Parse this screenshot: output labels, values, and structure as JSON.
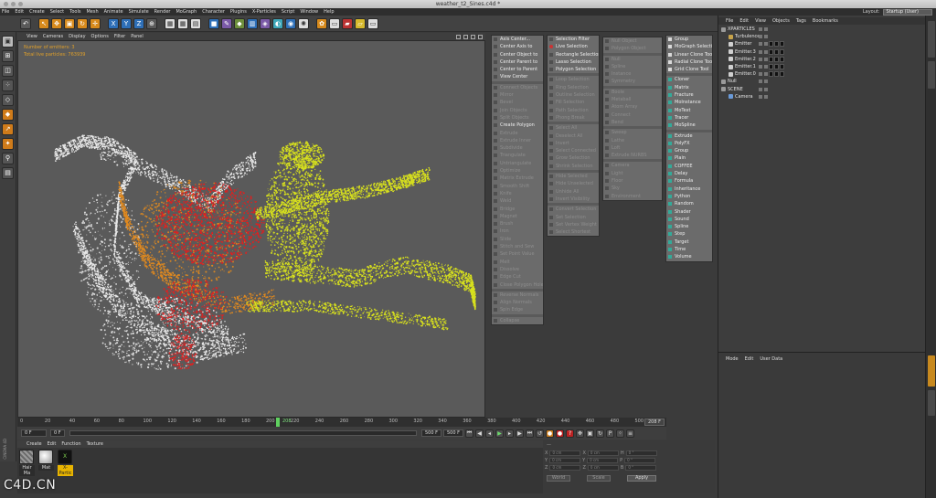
{
  "window": {
    "title": "weather_t2_Sines.c4d *"
  },
  "menubar": [
    "File",
    "Edit",
    "Create",
    "Select",
    "Tools",
    "Mesh",
    "Animate",
    "Simulate",
    "Render",
    "MoGraph",
    "Character",
    "Plugins",
    "X-Particles",
    "Script",
    "Window",
    "Help"
  ],
  "layout": {
    "label": "Layout:",
    "value": "Startup (User)"
  },
  "viewport": {
    "menu": [
      "View",
      "Cameras",
      "Display",
      "Options",
      "Filter",
      "Panel"
    ],
    "hud": [
      "Number of emitters: 3",
      "Total live particles: 763939"
    ],
    "colors": {
      "white": "#e8e8e8",
      "orange": "#e0891f",
      "red": "#e02020",
      "yellow": "#d7e01e",
      "bg": "#5a5a5a"
    }
  },
  "timeline": {
    "ticks": [
      "0",
      "20",
      "40",
      "60",
      "80",
      "100",
      "120",
      "140",
      "160",
      "180",
      "200",
      "220",
      "240",
      "260",
      "280",
      "300",
      "320",
      "340",
      "360",
      "380",
      "400",
      "420",
      "440",
      "460",
      "480",
      "500"
    ],
    "current": "208",
    "end": "208 F"
  },
  "transport": {
    "start": "0 F",
    "start2": "0 F",
    "end": "500 F",
    "end2": "500 F"
  },
  "materials": {
    "menu": [
      "Create",
      "Edit",
      "Function",
      "Texture"
    ],
    "items": [
      {
        "name": "Hair Ma",
        "color": "#8a8a8a"
      },
      {
        "name": "Mat",
        "color": "#e6e6e6"
      },
      {
        "name": "X-Partic",
        "color": "#1c1c1c"
      }
    ]
  },
  "coords": {
    "rows": [
      {
        "a": "X",
        "av": "0 cm",
        "b": "X",
        "bv": "0 cm",
        "c": "H",
        "cv": "0 °"
      },
      {
        "a": "Y",
        "av": "0 cm",
        "b": "Y",
        "bv": "0 cm",
        "c": "P",
        "cv": "0 °"
      },
      {
        "a": "Z",
        "av": "0 cm",
        "b": "Z",
        "bv": "0 cm",
        "c": "B",
        "cv": "0 °"
      }
    ],
    "mode1": "World",
    "mode2": "Scale",
    "apply": "Apply"
  },
  "menus": {
    "col1": [
      {
        "label": "Axis Center...",
        "dim": false
      },
      {
        "label": "Center Axis to",
        "dim": false
      },
      {
        "label": "Center Object to",
        "dim": false
      },
      {
        "label": "Center Parent to",
        "dim": false
      },
      {
        "label": "Center to Parent",
        "dim": false
      },
      {
        "label": "View Center",
        "dim": false
      },
      {
        "label": "---"
      },
      {
        "label": "Connect Objects",
        "dim": true
      },
      {
        "label": "Mirror",
        "dim": true
      },
      {
        "label": "Bevel",
        "dim": true
      },
      {
        "label": "Join Objects",
        "dim": true
      },
      {
        "label": "Split Objects",
        "dim": true
      },
      {
        "label": "Create Polygon",
        "dim": false
      },
      {
        "label": "Extrude",
        "dim": true
      },
      {
        "label": "Extrude Inner",
        "dim": true
      },
      {
        "label": "Subdivide",
        "dim": true
      },
      {
        "label": "Triangulate",
        "dim": true
      },
      {
        "label": "Untriangulate",
        "dim": true
      },
      {
        "label": "Optimize",
        "dim": true
      },
      {
        "label": "Matrix Extrude",
        "dim": true
      },
      {
        "label": "Smooth Shift",
        "dim": true
      },
      {
        "label": "Knife",
        "dim": true
      },
      {
        "label": "Weld",
        "dim": true
      },
      {
        "label": "Bridge",
        "dim": true
      },
      {
        "label": "Magnet",
        "dim": true
      },
      {
        "label": "Brush",
        "dim": true
      },
      {
        "label": "Iron",
        "dim": true
      },
      {
        "label": "Slide",
        "dim": true
      },
      {
        "label": "Stitch and Sew",
        "dim": true
      },
      {
        "label": "Set Point Value",
        "dim": true
      },
      {
        "label": "Melt",
        "dim": true
      },
      {
        "label": "Dissolve",
        "dim": true
      },
      {
        "label": "Edge Cut",
        "dim": true
      },
      {
        "label": "Close Polygon Hole",
        "dim": true
      },
      {
        "label": "---"
      },
      {
        "label": "Reverse Normals",
        "dim": true
      },
      {
        "label": "Align Normals",
        "dim": true
      },
      {
        "label": "Spin Edge",
        "dim": true
      },
      {
        "label": "---"
      },
      {
        "label": "Collapse",
        "dim": true
      }
    ],
    "col2": [
      {
        "label": "Selection Filter",
        "dim": false
      },
      {
        "label": "Live Selection",
        "dim": false,
        "dot": true
      },
      {
        "label": "Rectangle Selection",
        "dim": false
      },
      {
        "label": "Lasso Selection",
        "dim": false
      },
      {
        "label": "Polygon Selection",
        "dim": false
      },
      {
        "label": "---"
      },
      {
        "label": "Loop Selection",
        "dim": true
      },
      {
        "label": "Ring Selection",
        "dim": true
      },
      {
        "label": "Outline Selection",
        "dim": true
      },
      {
        "label": "Fill Selection",
        "dim": true
      },
      {
        "label": "Path Selection",
        "dim": true
      },
      {
        "label": "Phong Break",
        "dim": true
      },
      {
        "label": "---"
      },
      {
        "label": "Select All",
        "dim": true
      },
      {
        "label": "Deselect All",
        "dim": true
      },
      {
        "label": "Invert",
        "dim": true
      },
      {
        "label": "Select Connected",
        "dim": true
      },
      {
        "label": "Grow Selection",
        "dim": true
      },
      {
        "label": "Shrink Selection",
        "dim": true
      },
      {
        "label": "---"
      },
      {
        "label": "Hide Selected",
        "dim": true
      },
      {
        "label": "Hide Unselected",
        "dim": true
      },
      {
        "label": "Unhide All",
        "dim": true
      },
      {
        "label": "Invert Visibility",
        "dim": true
      },
      {
        "label": "---"
      },
      {
        "label": "Convert Selection",
        "dim": true
      },
      {
        "label": "Set Selection",
        "dim": true
      },
      {
        "label": "Set Vertex Weight",
        "dim": true
      },
      {
        "label": "Select Shortest",
        "dim": true
      }
    ],
    "col3": [
      {
        "label": "Null Object",
        "dim": true
      },
      {
        "label": "Polygon Object",
        "dim": true
      },
      {
        "label": "---"
      },
      {
        "label": "Null",
        "dim": true
      },
      {
        "label": "Spline",
        "dim": true
      },
      {
        "label": "Instance",
        "dim": true
      },
      {
        "label": "Symmetry",
        "dim": true
      },
      {
        "label": "---"
      },
      {
        "label": "Boole",
        "dim": true
      },
      {
        "label": "Metaball",
        "dim": true
      },
      {
        "label": "Atom Array",
        "dim": true
      },
      {
        "label": "Connect",
        "dim": true
      },
      {
        "label": "Bend",
        "dim": true
      },
      {
        "label": "---"
      },
      {
        "label": "Sweep",
        "dim": true
      },
      {
        "label": "Lathe",
        "dim": true
      },
      {
        "label": "Loft",
        "dim": true
      },
      {
        "label": "Extrude NURBS",
        "dim": true
      },
      {
        "label": "---"
      },
      {
        "label": "Camera",
        "dim": true
      },
      {
        "label": "Light",
        "dim": true
      },
      {
        "label": "Floor",
        "dim": true
      },
      {
        "label": "Sky",
        "dim": true
      },
      {
        "label": "Environment",
        "dim": true
      }
    ],
    "col4": [
      {
        "label": "Group",
        "dim": false,
        "cls": "ic2"
      },
      {
        "label": "MoGraph Selection",
        "dim": false,
        "cls": "ic2"
      },
      {
        "label": "Linear Clone Tool",
        "dim": false,
        "cls": "ic2"
      },
      {
        "label": "Radial Clone Tool",
        "dim": false,
        "cls": "ic2"
      },
      {
        "label": "Grid Clone Tool",
        "dim": false,
        "cls": "ic2"
      },
      {
        "label": "---"
      },
      {
        "label": "Cloner",
        "dim": false,
        "cls": "ic"
      },
      {
        "label": "Matrix",
        "dim": false,
        "cls": "ic"
      },
      {
        "label": "Fracture",
        "dim": false,
        "cls": "ic"
      },
      {
        "label": "MoInstance",
        "dim": false,
        "cls": "ic"
      },
      {
        "label": "MoText",
        "dim": false,
        "cls": "ic"
      },
      {
        "label": "Tracer",
        "dim": false,
        "cls": "ic"
      },
      {
        "label": "MoSpline",
        "dim": false,
        "cls": "ic"
      },
      {
        "label": "---"
      },
      {
        "label": "Extrude",
        "dim": false,
        "cls": "ic"
      },
      {
        "label": "PolyFX",
        "dim": false,
        "cls": "ic"
      },
      {
        "label": "Group",
        "dim": false,
        "cls": "ic"
      },
      {
        "label": "Plain",
        "dim": false,
        "cls": "ic"
      },
      {
        "label": "COFFEE",
        "dim": false,
        "cls": "ic"
      },
      {
        "label": "Delay",
        "dim": false,
        "cls": "ic"
      },
      {
        "label": "Formula",
        "dim": false,
        "cls": "ic"
      },
      {
        "label": "Inheritance",
        "dim": false,
        "cls": "ic"
      },
      {
        "label": "Python",
        "dim": false,
        "cls": "ic"
      },
      {
        "label": "Random",
        "dim": false,
        "cls": "ic"
      },
      {
        "label": "Shader",
        "dim": false,
        "cls": "ic"
      },
      {
        "label": "Sound",
        "dim": false,
        "cls": "ic"
      },
      {
        "label": "Spline",
        "dim": false,
        "cls": "ic"
      },
      {
        "label": "Step",
        "dim": false,
        "cls": "ic"
      },
      {
        "label": "Target",
        "dim": false,
        "cls": "ic"
      },
      {
        "label": "Time",
        "dim": false,
        "cls": "ic"
      },
      {
        "label": "Volume",
        "dim": false,
        "cls": "ic"
      }
    ]
  },
  "objmgr": {
    "menu": [
      "File",
      "Edit",
      "View",
      "Objects",
      "Tags",
      "Bookmarks"
    ],
    "items": [
      {
        "name": "XPARTICLES",
        "indent": 0,
        "color": "#9a9a9a"
      },
      {
        "name": "Turbulence",
        "indent": 1,
        "color": "#c7a34a"
      },
      {
        "name": "Emitter",
        "indent": 1,
        "color": "#d0d0d0"
      },
      {
        "name": "Emitter.3",
        "indent": 1,
        "color": "#d0d0d0"
      },
      {
        "name": "Emitter.2",
        "indent": 1,
        "color": "#d0d0d0"
      },
      {
        "name": "Emitter.1",
        "indent": 1,
        "color": "#d0d0d0"
      },
      {
        "name": "Emitter.0",
        "indent": 1,
        "color": "#d0d0d0"
      },
      {
        "name": "Null",
        "indent": 0,
        "color": "#9a9a9a"
      },
      {
        "name": "SCENE",
        "indent": 0,
        "color": "#9a9a9a"
      },
      {
        "name": "Camera",
        "indent": 1,
        "color": "#6a9ad8"
      }
    ]
  },
  "attrmgr": {
    "menu": [
      "Mode",
      "Edit",
      "User Data"
    ]
  },
  "watermark": "C4D.CN",
  "side_watermark": "CINEMA 4D"
}
